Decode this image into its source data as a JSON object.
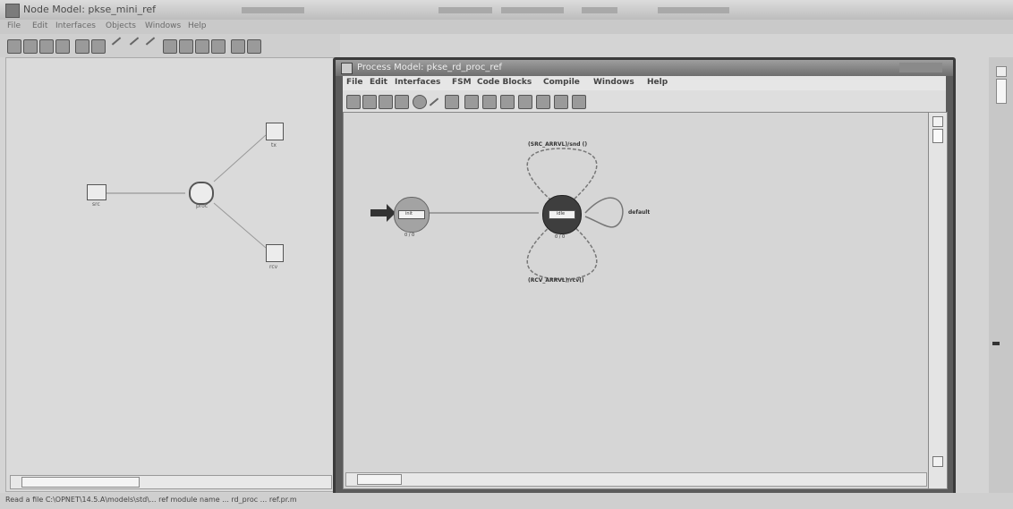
{
  "window": {
    "title": "Node Model: pkse_mini_ref"
  },
  "menubar": {
    "items": [
      "File",
      "Edit",
      "Interfaces",
      "Objects",
      "Windows",
      "Help"
    ]
  },
  "node_model": {
    "nodes": [
      {
        "label": "src"
      },
      {
        "label": "proc"
      },
      {
        "label": "tx"
      },
      {
        "label": "rcv"
      }
    ]
  },
  "process_window": {
    "title": "Process Model: pkse_rd_proc_ref",
    "menu": [
      "File",
      "Edit",
      "Interfaces",
      "FSM",
      "Code Blocks",
      "Compile",
      "Windows",
      "Help"
    ],
    "states": [
      {
        "name": "init",
        "counter": "0 / 0"
      },
      {
        "name": "idle",
        "counter": "0 / 0"
      }
    ],
    "transitions": [
      {
        "label": "(SRC_ARRVL)/snd ()"
      },
      {
        "label": "default"
      },
      {
        "label": "(RCV_ARRVL)/rcv()"
      }
    ]
  },
  "status": {
    "text": "Read a file C:\\OPNET\\14.5.A\\models\\std\\... ref module name ... rd_proc ... ref.pr.m"
  }
}
